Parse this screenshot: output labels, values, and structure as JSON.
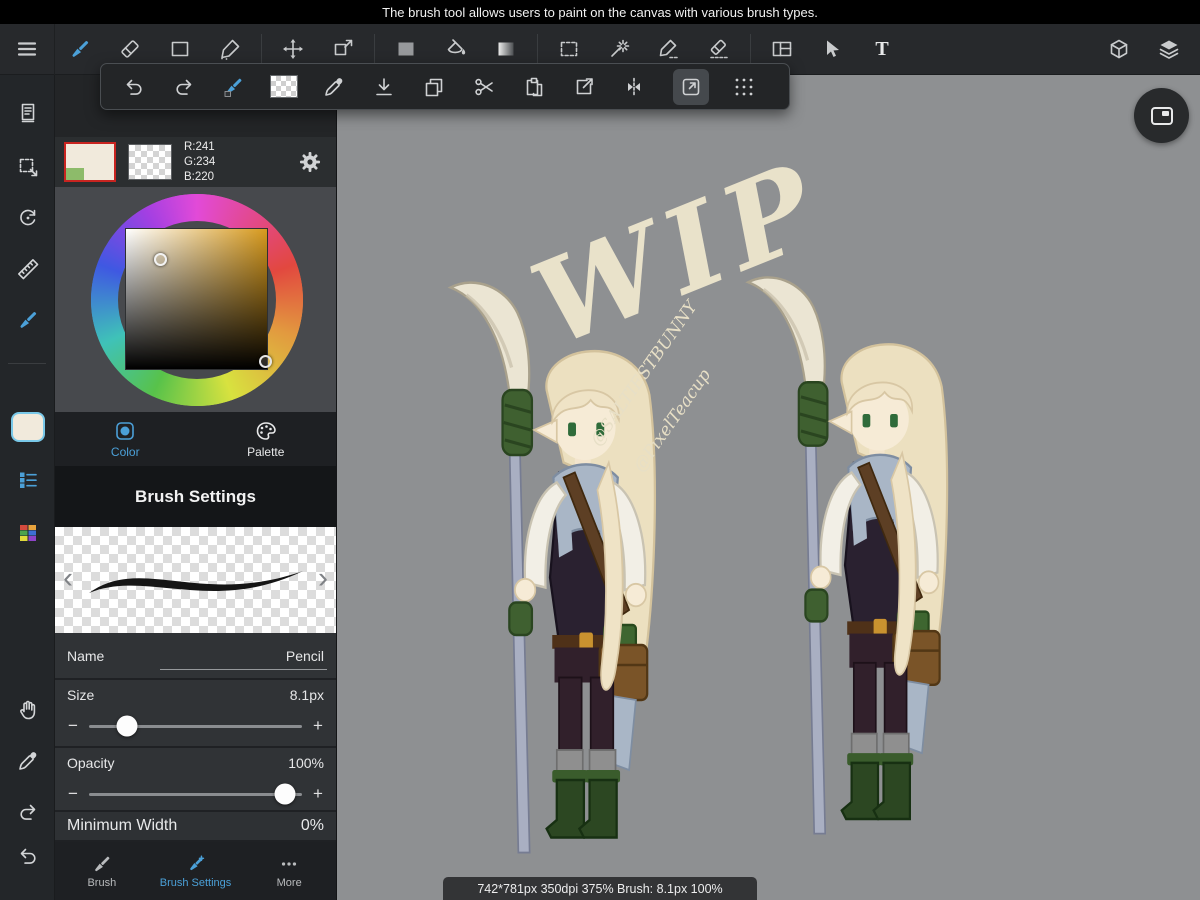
{
  "banner": {
    "text": "The brush tool allows users to paint on the canvas with various brush types."
  },
  "colors": {
    "accent": "#4ba0d8",
    "canvas_bg": "#8e9092",
    "foreground": "#f1eadc"
  },
  "swatch_row": {
    "r": "R:241",
    "g": "G:234",
    "b": "B:220"
  },
  "color_tabs": {
    "color": "Color",
    "palette": "Palette"
  },
  "brush_settings": {
    "title": "Brush Settings",
    "name_label": "Name",
    "name_value": "Pencil",
    "size_label": "Size",
    "size_value": "8.1px",
    "opacity_label": "Opacity",
    "opacity_value": "100%",
    "min_width_label": "Minimum Width",
    "min_width_value": "0%",
    "prev_glyph": "‹",
    "next_glyph": "›",
    "minus_glyph": "−",
    "plus_glyph": "+"
  },
  "bottom_tabs": {
    "brush": "Brush",
    "settings": "Brush Settings",
    "more": "More"
  },
  "toolbar": {
    "text_tool_glyph": "T"
  },
  "canvas": {
    "wip": "WIP",
    "watermark_1": "@SALTIESTBUNNY",
    "watermark_2": "@PixelTeacup",
    "status": "742*781px 350dpi 375% Brush: 8.1px 100%"
  }
}
